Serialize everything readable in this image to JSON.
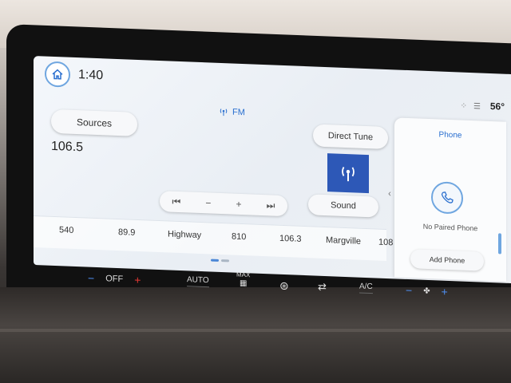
{
  "status_bar": {
    "time": "1:40",
    "temperature": "56°"
  },
  "radio": {
    "band": "FM",
    "frequency": "106.5",
    "sources_label": "Sources",
    "direct_tune_label": "Direct Tune",
    "sound_label": "Sound",
    "transport": {
      "prev": "⏮",
      "minus": "−",
      "plus": "+",
      "next": "⏭"
    },
    "presets": [
      "540",
      "89.9",
      "Highway",
      "810",
      "106.3",
      "Margville",
      "108"
    ]
  },
  "phone_panel": {
    "title": "Phone",
    "status": "No Paired Phone",
    "add_label": "Add Phone"
  },
  "climate": {
    "fan_minus": "−",
    "fan_state": "OFF",
    "fan_plus": "+",
    "auto_label": "AUTO",
    "max_label": "MAX",
    "ac_label": "A/C",
    "right_minus": "−",
    "right_plus": "+"
  },
  "colors": {
    "accent": "#2a6fcf",
    "station_art": "#2d58b7"
  }
}
